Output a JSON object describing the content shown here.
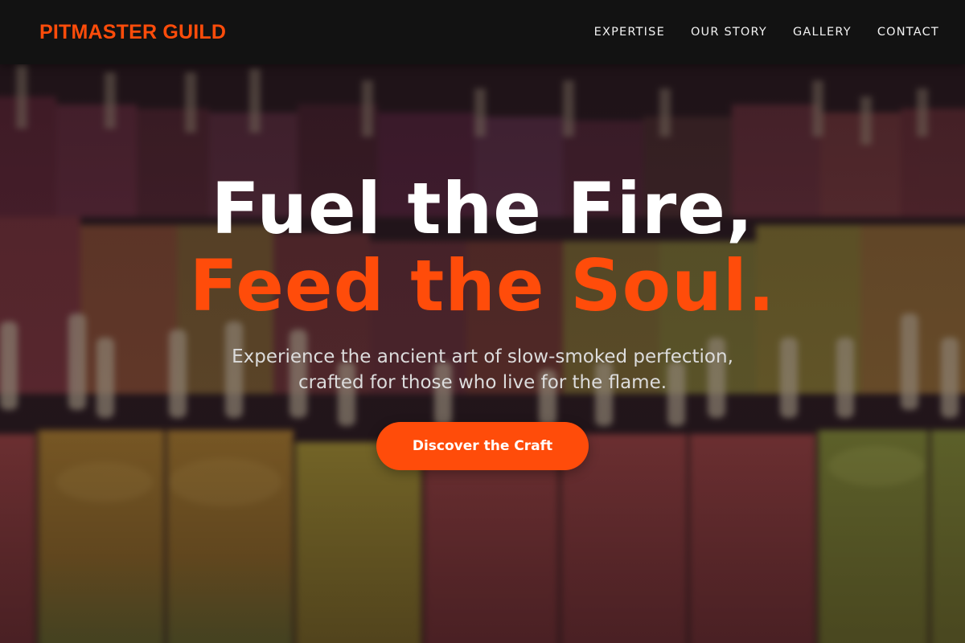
{
  "nav": {
    "logo": "PITMASTER GUILD",
    "links": [
      "EXPERTISE",
      "OUR STORY",
      "GALLERY",
      "CONTACT"
    ]
  },
  "hero": {
    "headline_line1": "Fuel the Fire,",
    "headline_line2": "Feed the Soul.",
    "subtitle_line1": "Experience the ancient art of slow-smoked perfection,",
    "subtitle_line2": "crafted for those who live for the flame.",
    "cta_label": "Discover the Craft"
  },
  "colors": {
    "accent": "#ff4c0a",
    "navbar_bg": "#121212",
    "headline": "#ffffff",
    "subtitle": "#dcdcdc"
  }
}
